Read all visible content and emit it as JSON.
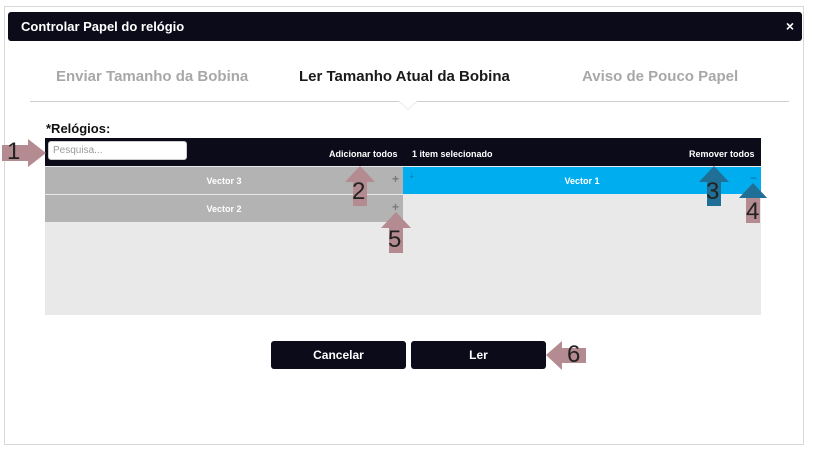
{
  "dialog": {
    "title": "Controlar Papel do relógio",
    "close_glyph": "×"
  },
  "tabs": [
    {
      "label": "Enviar Tamanho da Bobina",
      "active": false
    },
    {
      "label": "Ler Tamanho Atual da Bobina",
      "active": true
    },
    {
      "label": "Aviso de Pouco Papel",
      "active": false
    }
  ],
  "form": {
    "relogios_label": "*Relógios:",
    "search_placeholder": "Pesquisa...",
    "add_all": "Adicionar todos",
    "selected_count": "1 item selecionado",
    "remove_all": "Remover todos"
  },
  "available_items": [
    {
      "name": "Vector 3",
      "action_glyph": "+"
    },
    {
      "name": "Vector 2",
      "action_glyph": "+"
    }
  ],
  "selected_items": [
    {
      "name": "Vector 1",
      "action_glyph": "−",
      "drag_glyph": "⇣"
    }
  ],
  "buttons": {
    "cancel": "Cancelar",
    "read": "Ler"
  },
  "callouts": [
    "1",
    "2",
    "3",
    "4",
    "5",
    "6"
  ],
  "colors": {
    "dark": "#0b0b1a",
    "selected_item": "#00adef",
    "available_item": "#b3b3b3",
    "arrow_pink": "#b48b90",
    "arrow_blue": "#1f6f96"
  },
  "icons": [
    "close-icon",
    "plus-icon",
    "minus-icon",
    "drag-handle-icon",
    "arrow-callout-icon"
  ]
}
